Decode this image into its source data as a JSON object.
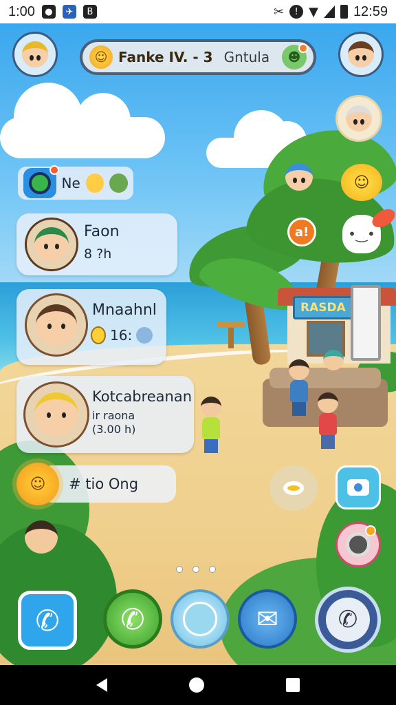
{
  "status_bar": {
    "time": "1:00",
    "clock": "12:59",
    "left_icons": [
      "circle-o-icon",
      "map-icon",
      "b-icon"
    ],
    "right_icons": [
      "scissors-icon",
      "shield-icon",
      "wifi-icon",
      "signal-icon",
      "battery-icon"
    ]
  },
  "top_bar": {
    "title": "Fanke IV. - 3",
    "subtitle": "Gntula"
  },
  "mini_widget": {
    "label": "Ne"
  },
  "cards": [
    {
      "name": "Faon",
      "meta": "8 ?h"
    },
    {
      "name": "Mnaahnl",
      "meta": "16:"
    },
    {
      "name": "Kotcabreanan",
      "meta_line1": "ir raona",
      "meta_line2": "(3.00    h)"
    }
  ],
  "status_pill": {
    "text": "# tio Ong"
  },
  "hut_sign": "RASDA",
  "speech_bubble": "a!",
  "dock": [
    "phone-app",
    "phone-call",
    "browser",
    "messages",
    "dialer"
  ],
  "colors": {
    "sky": "#3aa7ee",
    "sea": "#2b9fd8",
    "sand": "#efcf8c",
    "card_bg": "#e8f0fa",
    "accent_green": "#39b54a",
    "accent_blue": "#2a8fe0"
  }
}
